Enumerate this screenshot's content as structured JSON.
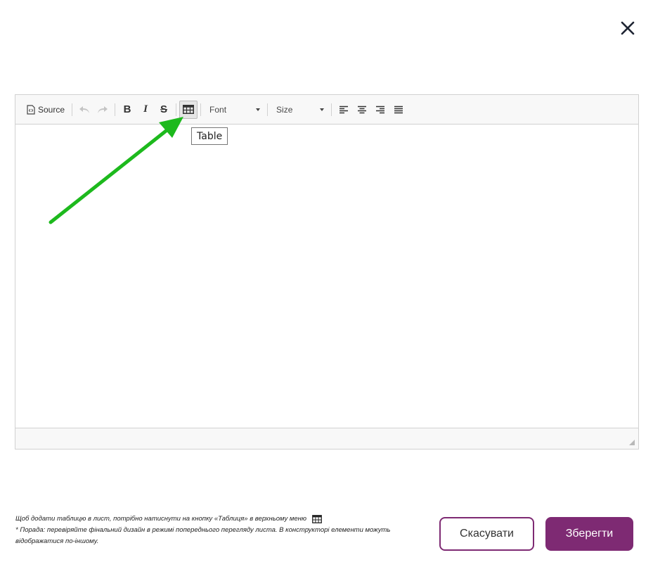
{
  "toolbar": {
    "source_label": "Source",
    "font_label": "Font",
    "size_label": "Size",
    "tooltip": "Table"
  },
  "hints": {
    "line1": "Щоб додати таблицю в лист, потрібно натиснути на кнопку «Таблиця» в верхньому меню",
    "line2": "* Порада: перевіряйте фінальний дизайн в режимі попереднього перегляду листа. В конструкторі елементи можуть відображатися по-іншому."
  },
  "buttons": {
    "cancel": "Скасувати",
    "save": "Зберегти"
  },
  "colors": {
    "accent": "#7e2a73",
    "arrow": "#1db91d"
  }
}
